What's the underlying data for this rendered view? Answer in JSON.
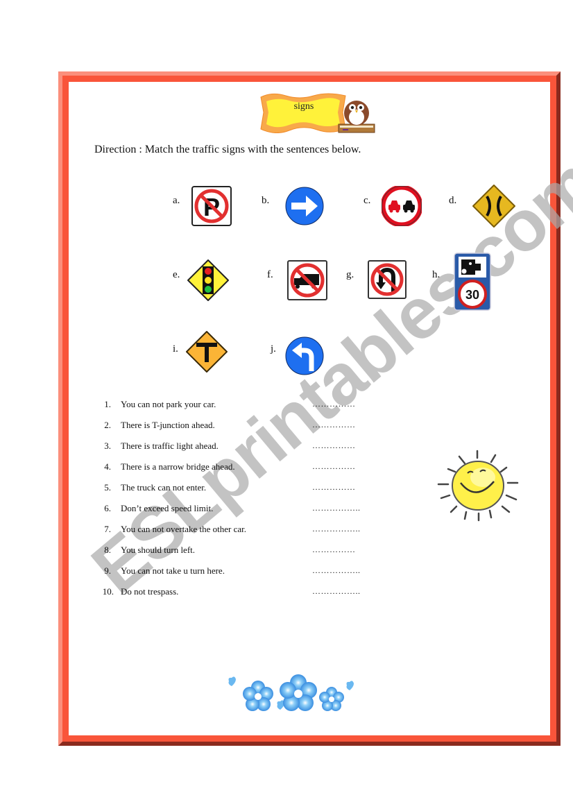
{
  "worksheet": {
    "title": "signs",
    "direction": "Direction : Match the traffic signs with the sentences below.",
    "watermark": "ESLprintables.com"
  },
  "signs": [
    {
      "label": "a.",
      "icon": "no-parking-sign-icon"
    },
    {
      "label": "b.",
      "icon": "turn-right-arrow-sign-icon"
    },
    {
      "label": "c.",
      "icon": "no-overtaking-sign-icon"
    },
    {
      "label": "d.",
      "icon": "narrow-bridge-sign-icon"
    },
    {
      "label": "e.",
      "icon": "traffic-light-ahead-sign-icon"
    },
    {
      "label": "f.",
      "icon": "no-trucks-sign-icon"
    },
    {
      "label": "g.",
      "icon": "no-u-turn-sign-icon"
    },
    {
      "label": "h.",
      "icon": "speed-camera-30-sign-icon",
      "speed": "30"
    },
    {
      "label": "i.",
      "icon": "t-junction-sign-icon"
    },
    {
      "label": "j.",
      "icon": "turn-left-arrow-sign-icon"
    }
  ],
  "questions": [
    {
      "num": "1.",
      "text": "You can not park your car.",
      "blank": "……………"
    },
    {
      "num": "2.",
      "text": "There is T-junction ahead.",
      "blank": "……………"
    },
    {
      "num": "3.",
      "text": "There is traffic light ahead.",
      "blank": "……………"
    },
    {
      "num": "4.",
      "text": "There is a narrow bridge ahead.",
      "blank": "……………"
    },
    {
      "num": "5.",
      "text": "The truck can not enter.",
      "blank": "……………"
    },
    {
      "num": "6.",
      "text": " Don’t exceed speed limit.",
      "blank": "…………….."
    },
    {
      "num": "7.",
      "text": "You can not overtake the other car.",
      "blank": "…………….."
    },
    {
      "num": "8.",
      "text": "You should turn left.",
      "blank": "……………"
    },
    {
      "num": "9.",
      "text": "You can not take u turn here.",
      "blank": "…………….."
    },
    {
      "num": "10.",
      "text": "Do not trespass.",
      "blank": "…………….."
    }
  ],
  "decorations": [
    "owl-on-book-icon",
    "smiling-sun-icon",
    "blue-flowers-icon"
  ]
}
